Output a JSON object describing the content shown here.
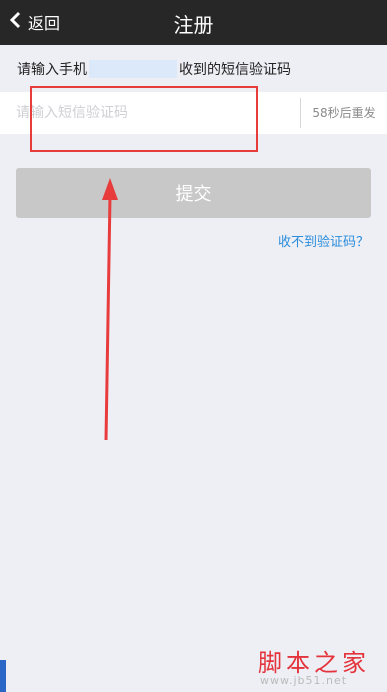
{
  "header": {
    "back_label": "返回",
    "title": "注册"
  },
  "hint": {
    "prefix": "请输入手机",
    "suffix": "收到的短信验证码"
  },
  "code_input": {
    "placeholder": "请输入短信验证码",
    "value": ""
  },
  "resend_label": "58秒后重发",
  "submit_label": "提交",
  "no_code_link": "收不到验证码？",
  "watermark": {
    "name": "脚本之家",
    "url": "www.jb51.net"
  },
  "colors": {
    "header_bg": "#272727",
    "page_bg": "#eeeef5",
    "annotation_red": "#e83b3b",
    "link_blue": "#2a8ddb",
    "button_disabled": "#c8c8c8"
  }
}
